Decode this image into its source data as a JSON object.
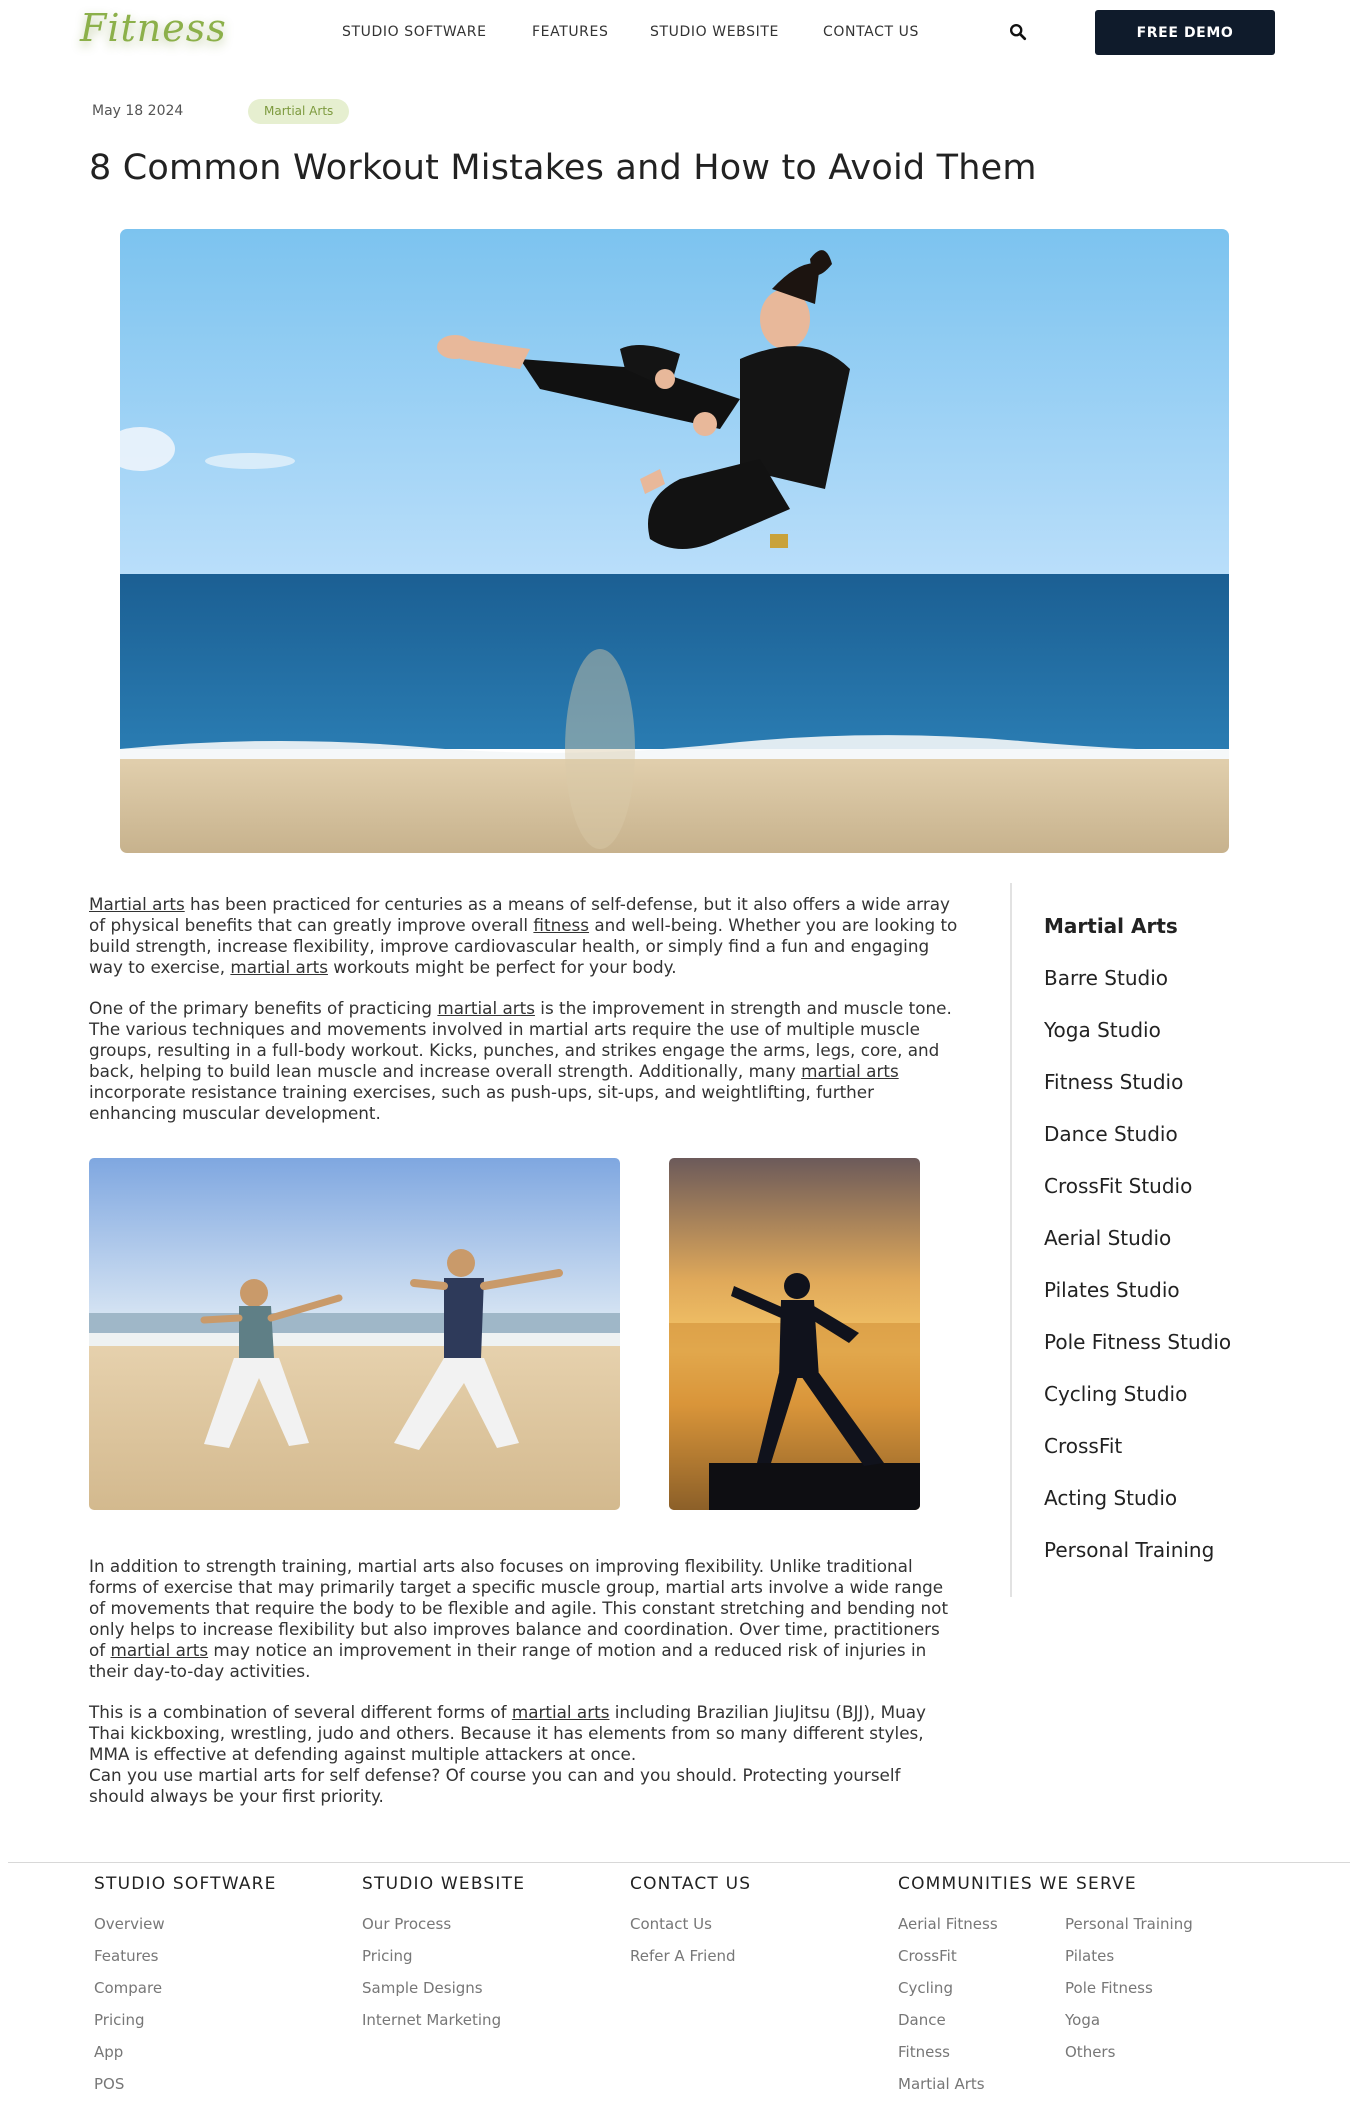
{
  "header": {
    "logo_text": "Fitness",
    "nav": [
      "STUDIO SOFTWARE",
      "FEATURES",
      "STUDIO WEBSITE",
      "CONTACT US"
    ],
    "search_icon": "search-icon",
    "cta_label": "FREE DEMO"
  },
  "post": {
    "date": "May 18 2024",
    "tag": "Martial Arts",
    "title": "8 Common Workout Mistakes and How to Avoid Them",
    "p1": {
      "a_link": "Martial arts",
      "b": " has been practiced for centuries as a means of self-defense, but it also offers a wide array of physical benefits that can greatly improve overall ",
      "c_link": "fitness",
      "d": " and well-being. Whether you are looking to build strength, increase flexibility, improve cardiovascular health, or simply find a fun and engaging way to exercise, ",
      "e_link": "martial arts",
      "f": " workouts might be perfect for your body."
    },
    "p2": {
      "a": "One of the primary benefits of practicing ",
      "b_link": "martial arts",
      "c": " is the improvement in strength and muscle tone. The various techniques and movements involved in martial arts require the use of multiple muscle groups, resulting in a full-body workout. Kicks, punches, and strikes engage the arms, legs, core, and back, helping to build lean muscle and increase overall strength. Additionally, many ",
      "d_link": "martial arts",
      "e": " incorporate resistance training exercises, such as push-ups, sit-ups, and weightlifting, further enhancing muscular development."
    },
    "p3": {
      "a": "In addition to strength training, martial arts also focuses on improving flexibility. Unlike traditional forms of exercise that may primarily target a specific muscle group, martial arts involve a wide range of movements that require the body to be flexible and agile. This constant stretching and bending not only helps to increase flexibility but also improves balance and coordination. Over time, practitioners of ",
      "b_link": "martial arts",
      "c": " may notice an improvement in their range of motion and a reduced risk of injuries in their day-to-day activities."
    },
    "p4": {
      "a": "This is a combination of several different forms of ",
      "b_link": "martial arts",
      "c": " including Brazilian JiuJitsu (BJJ), Muay Thai kickboxing, wrestling, judo and others. Because it has elements from so many different styles, MMA is effective at defending against multiple attackers at once.",
      "d": "Can you use martial arts for self defense? Of course you can and you should. Protecting yourself should always be your first priority."
    }
  },
  "sidebar": {
    "categories": [
      "Martial Arts",
      "Barre Studio",
      "Yoga Studio",
      "Fitness Studio",
      "Dance Studio",
      "CrossFit Studio",
      "Aerial Studio",
      "Pilates Studio",
      "Pole Fitness Studio",
      "Cycling Studio",
      "CrossFit",
      "Acting Studio",
      "Personal Training"
    ]
  },
  "footer": {
    "studio_software": {
      "heading": "STUDIO SOFTWARE",
      "links": [
        "Overview",
        "Features",
        "Compare",
        "Pricing",
        "App",
        "POS"
      ]
    },
    "studio_website": {
      "heading": "STUDIO WEBSITE",
      "links": [
        "Our Process",
        "Pricing",
        "Sample Designs",
        "Internet Marketing"
      ]
    },
    "contact_us": {
      "heading": "CONTACT US",
      "links": [
        "Contact Us",
        "Refer A Friend"
      ]
    },
    "communities": {
      "heading": "COMMUNITIES WE SERVE",
      "col1": [
        "Aerial Fitness",
        "CrossFit",
        "Cycling",
        "Dance",
        "Fitness",
        "Martial Arts"
      ],
      "col2": [
        "Personal Training",
        "Pilates",
        "Pole Fitness",
        "Yoga",
        "Others"
      ]
    }
  },
  "colors": {
    "logo_green": "#8cb04a",
    "cta_bg": "#0f1b2b",
    "tag_bg": "#e6efd0",
    "tag_text": "#7d9a3e"
  }
}
